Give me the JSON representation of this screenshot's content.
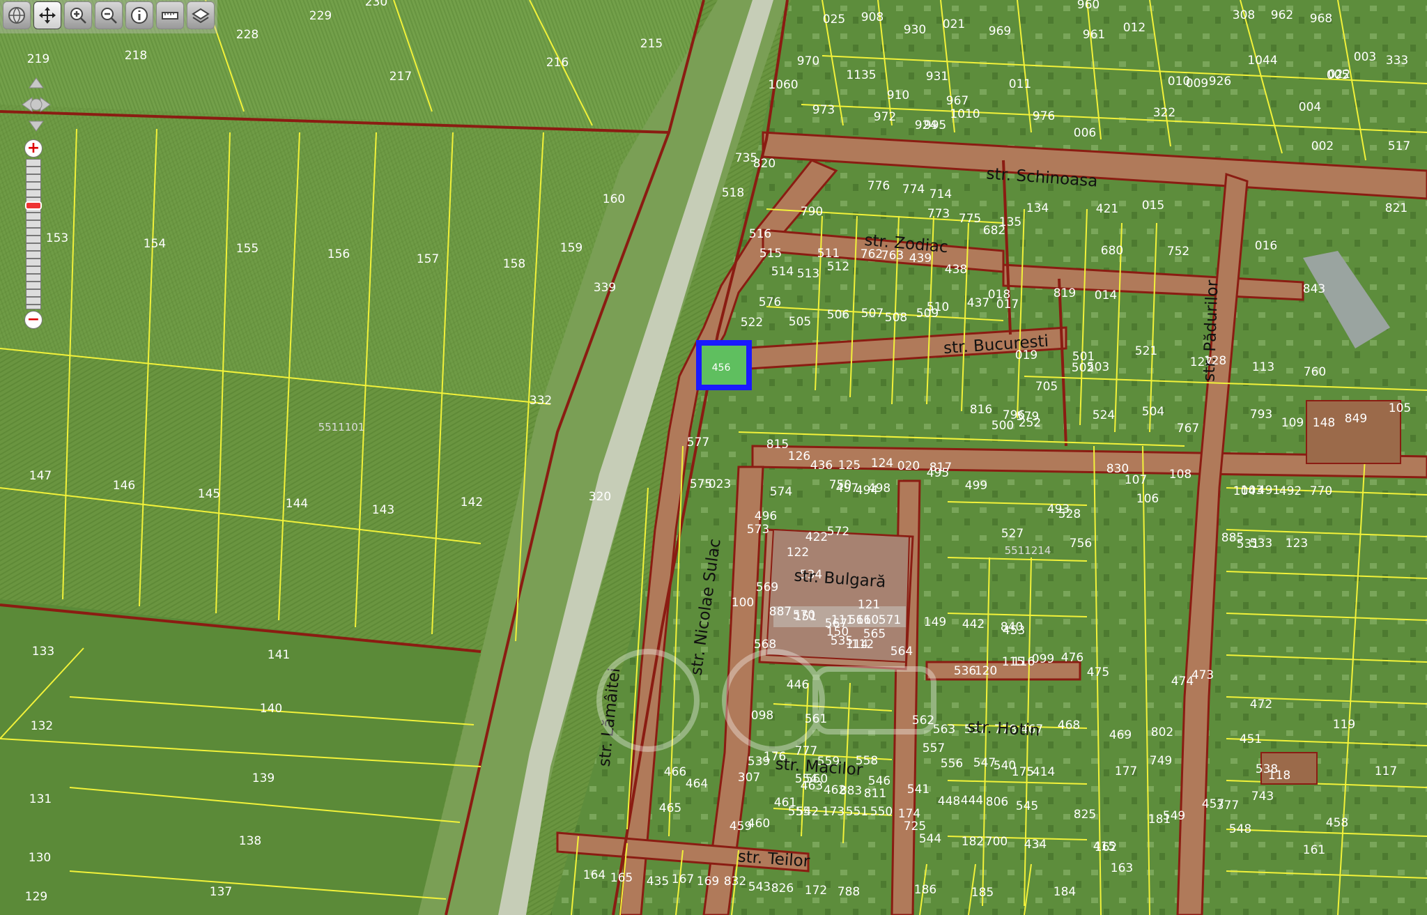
{
  "toolbar": {
    "tools": [
      {
        "name": "globe-icon"
      },
      {
        "name": "pan-icon"
      },
      {
        "name": "zoom-in-icon"
      },
      {
        "name": "zoom-out-icon"
      },
      {
        "name": "info-icon"
      },
      {
        "name": "measure-icon"
      },
      {
        "name": "layers-icon"
      }
    ],
    "active_tool": "pan-icon"
  },
  "zoom": {
    "plus": "+",
    "minus": "−",
    "level": 0.3
  },
  "colors": {
    "field_light": "#6f9a45",
    "field_dark": "#4e7a33",
    "parcel_line": "#f2f23a",
    "road_line": "#8a1c12",
    "road_fill": "#b07a5a",
    "highlight": "#1a1aff",
    "highlight_fill": "#5fbf5f"
  },
  "streets": [
    {
      "id": "schinoasa",
      "label": "str. Schinoasa"
    },
    {
      "id": "zodiac",
      "label": "str. Zodiac"
    },
    {
      "id": "bucuresti",
      "label": "str. Bucuresti"
    },
    {
      "id": "padurilor",
      "label": "str. Pădurilor"
    },
    {
      "id": "sulac",
      "label": "str. Nicolae Sulac"
    },
    {
      "id": "bulgara",
      "label": "str. Bulgară"
    },
    {
      "id": "hotin",
      "label": "str. Hotin"
    },
    {
      "id": "macilor",
      "label": "str. Macilor"
    },
    {
      "id": "lamaitei",
      "label": "str. Lămâitei"
    },
    {
      "id": "teilor",
      "label": "str. Teilor"
    }
  ],
  "cadastral_sectors": [
    "5511101",
    "5511214"
  ],
  "highlighted_parcel": "456",
  "parcels": [
    "230",
    "229",
    "228",
    "219",
    "218",
    "217",
    "216",
    "215",
    "153",
    "154",
    "155",
    "156",
    "157",
    "158",
    "159",
    "160",
    "339",
    "332",
    "147",
    "146",
    "145",
    "144",
    "143",
    "142",
    "320",
    "133",
    "141",
    "132",
    "140",
    "131",
    "139",
    "130",
    "138",
    "129",
    "137",
    "025",
    "908",
    "930",
    "021",
    "969",
    "960",
    "961",
    "012",
    "308",
    "962",
    "968",
    "003",
    "333",
    "970",
    "1060",
    "1135",
    "910",
    "931",
    "1044",
    "005",
    "973",
    "972",
    "967",
    "011",
    "010",
    "009",
    "926",
    "022",
    "924",
    "995",
    "1010",
    "976",
    "006",
    "322",
    "004",
    "002",
    "517",
    "820",
    "735",
    "518",
    "790",
    "776",
    "774",
    "714",
    "773",
    "775",
    "135",
    "134",
    "682",
    "421",
    "821",
    "015",
    "516",
    "680",
    "752",
    "016",
    "515",
    "514",
    "513",
    "512",
    "511",
    "762",
    "763",
    "439",
    "438",
    "437",
    "017",
    "014",
    "843",
    "576",
    "505",
    "506",
    "507",
    "508",
    "509",
    "510",
    "018",
    "819",
    "521",
    "127",
    "128",
    "113",
    "760",
    "019",
    "705",
    "501",
    "502",
    "503",
    "504",
    "767",
    "577",
    "522",
    "815",
    "126",
    "436",
    "125",
    "124",
    "020",
    "817",
    "816",
    "023",
    "750",
    "494",
    "495",
    "496",
    "497",
    "498",
    "499",
    "796",
    "500",
    "252",
    "579",
    "493",
    "528",
    "527",
    "756",
    "524",
    "830",
    "107",
    "106",
    "108",
    "104",
    "103",
    "491",
    "492",
    "770",
    "531",
    "885",
    "533",
    "123",
    "105",
    "793",
    "109",
    "148",
    "849",
    "575",
    "574",
    "573",
    "572",
    "534",
    "122",
    "422",
    "110",
    "149",
    "442",
    "840",
    "453",
    "568",
    "569",
    "570",
    "571",
    "535",
    "121",
    "446",
    "111",
    "150",
    "114",
    "112",
    "100",
    "887",
    "151",
    "567",
    "566",
    "565",
    "564",
    "536",
    "120",
    "115",
    "116",
    "099",
    "476",
    "475",
    "474",
    "473",
    "472",
    "119",
    "451",
    "538",
    "118",
    "117",
    "098",
    "307",
    "560",
    "561",
    "562",
    "563",
    "537",
    "778",
    "467",
    "468",
    "469",
    "802",
    "539",
    "176",
    "777",
    "559",
    "558",
    "557",
    "556",
    "547",
    "540",
    "175",
    "414",
    "177",
    "749",
    "743",
    "466",
    "465",
    "464",
    "463",
    "462",
    "883",
    "811",
    "554",
    "555",
    "546",
    "541",
    "174",
    "725",
    "448",
    "444",
    "806",
    "545",
    "825",
    "181",
    "457",
    "458",
    "459",
    "460",
    "461",
    "542",
    "173",
    "551",
    "550",
    "549",
    "548",
    "544",
    "182",
    "700",
    "434",
    "415",
    "161",
    "377",
    "162",
    "163",
    "164",
    "165",
    "435",
    "167",
    "169",
    "832",
    "543",
    "826",
    "172",
    "788",
    "186",
    "185",
    "184"
  ]
}
